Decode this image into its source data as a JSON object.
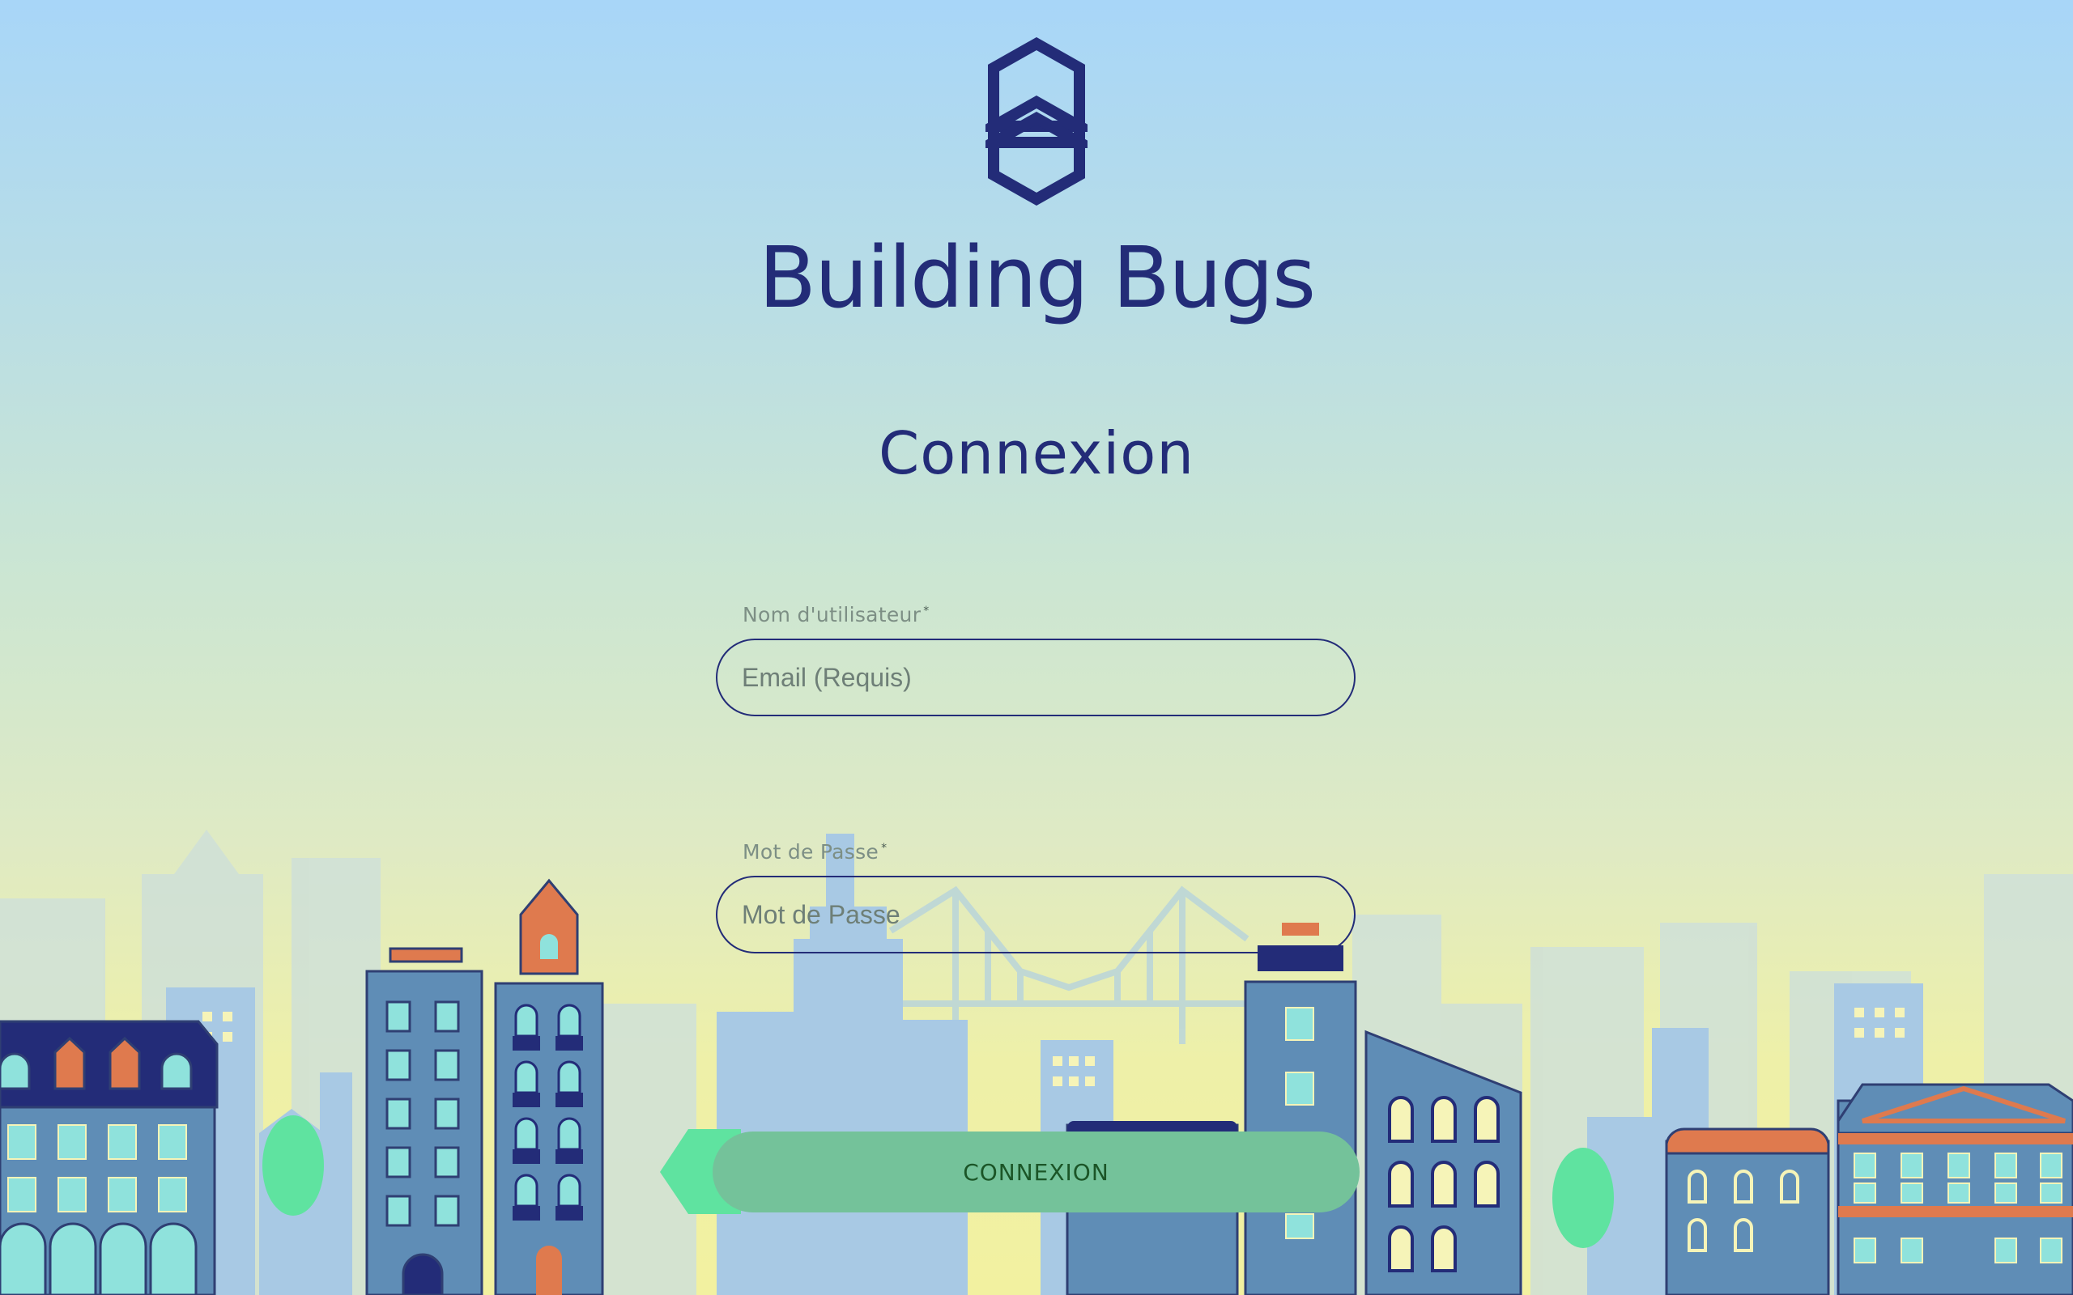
{
  "brand": {
    "name": "Building Bugs",
    "logo_icon": "hexagon-logo-icon",
    "color": "#232c78"
  },
  "login": {
    "heading": "Connexion",
    "username_label": "Nom d'utilisateur",
    "username_placeholder": "Email (Requis)",
    "username_value": "",
    "password_label": "Mot de Passe",
    "password_placeholder": "Mot de Passe",
    "password_value": "",
    "required_marker": "*",
    "submit_label": "CONNEXION"
  },
  "colors": {
    "accent": "#232c78",
    "button": "#74c29a",
    "button_text": "#1b5527"
  }
}
